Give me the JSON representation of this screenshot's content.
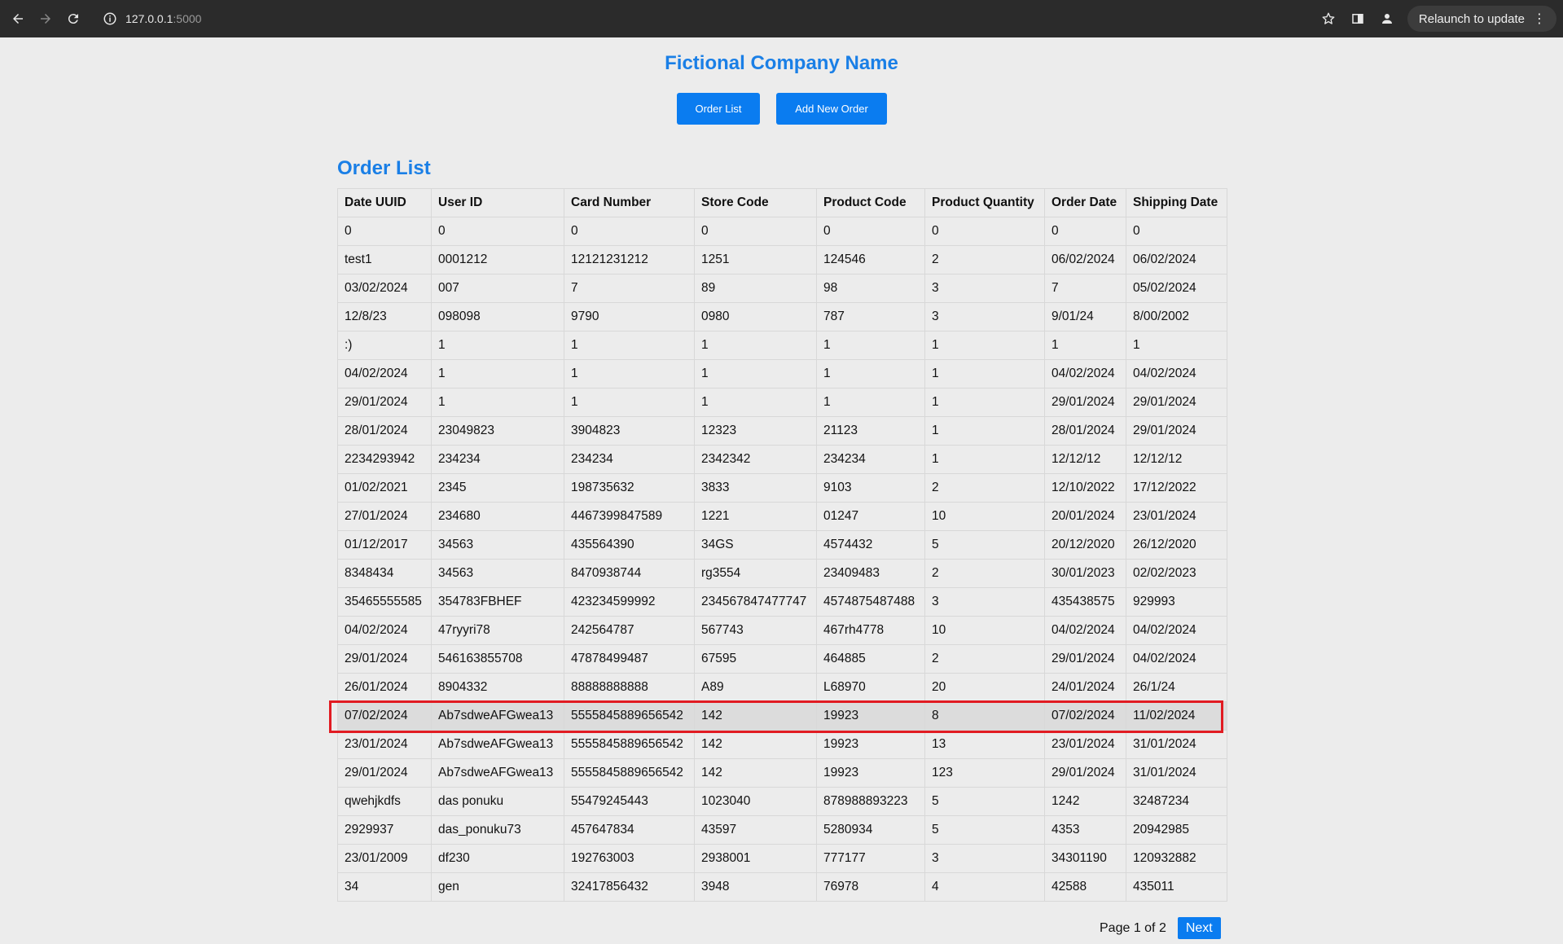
{
  "browser": {
    "url_host": "127.0.0.1",
    "url_port": ":5000",
    "relaunch_label": "Relaunch to update"
  },
  "header": {
    "company": "Fictional Company Name",
    "order_list_button": "Order List",
    "add_order_button": "Add New Order"
  },
  "main": {
    "title": "Order List",
    "columns": [
      "Date UUID",
      "User ID",
      "Card Number",
      "Store Code",
      "Product Code",
      "Product Quantity",
      "Order Date",
      "Shipping Date"
    ],
    "rows": [
      [
        "0",
        "0",
        "0",
        "0",
        "0",
        "0",
        "0",
        "0"
      ],
      [
        "test1",
        "0001212",
        "12121231212",
        "1251",
        "124546",
        "2",
        "06/02/2024",
        "06/02/2024"
      ],
      [
        "03/02/2024",
        "007",
        "7",
        "89",
        "98",
        "3",
        "7",
        "05/02/2024"
      ],
      [
        "12/8/23",
        "098098",
        "9790",
        "0980",
        "787",
        "3",
        "9/01/24",
        "8/00/2002"
      ],
      [
        ":)",
        "1",
        "1",
        "1",
        "1",
        "1",
        "1",
        "1"
      ],
      [
        "04/02/2024",
        "1",
        "1",
        "1",
        "1",
        "1",
        "04/02/2024",
        "04/02/2024"
      ],
      [
        "29/01/2024",
        "1",
        "1",
        "1",
        "1",
        "1",
        "29/01/2024",
        "29/01/2024"
      ],
      [
        "28/01/2024",
        "23049823",
        "3904823",
        "12323",
        "21123",
        "1",
        "28/01/2024",
        "29/01/2024"
      ],
      [
        "2234293942",
        "234234",
        "234234",
        "2342342",
        "234234",
        "1",
        "12/12/12",
        "12/12/12"
      ],
      [
        "01/02/2021",
        "2345",
        "198735632",
        "3833",
        "9103",
        "2",
        "12/10/2022",
        "17/12/2022"
      ],
      [
        "27/01/2024",
        "234680",
        "4467399847589",
        "1221",
        "01247",
        "10",
        "20/01/2024",
        "23/01/2024"
      ],
      [
        "01/12/2017",
        "34563",
        "435564390",
        "34GS",
        "4574432",
        "5",
        "20/12/2020",
        "26/12/2020"
      ],
      [
        "8348434",
        "34563",
        "8470938744",
        "rg3554",
        "23409483",
        "2",
        "30/01/2023",
        "02/02/2023"
      ],
      [
        "35465555585",
        "354783FBHEF",
        "423234599992",
        "234567847477747",
        "4574875487488",
        "3",
        "435438575",
        "929993"
      ],
      [
        "04/02/2024",
        "47ryyri78",
        "242564787",
        "567743",
        "467rh4778",
        "10",
        "04/02/2024",
        "04/02/2024"
      ],
      [
        "29/01/2024",
        "546163855708",
        "47878499487",
        "67595",
        "464885",
        "2",
        "29/01/2024",
        "04/02/2024"
      ],
      [
        "26/01/2024",
        "8904332",
        "88888888888",
        "A89",
        "L68970",
        "20",
        "24/01/2024",
        "26/1/24"
      ],
      [
        "07/02/2024",
        "Ab7sdweAFGwea13",
        "5555845889656542",
        "142",
        "19923",
        "8",
        "07/02/2024",
        "11/02/2024"
      ],
      [
        "23/01/2024",
        "Ab7sdweAFGwea13",
        "5555845889656542",
        "142",
        "19923",
        "13",
        "23/01/2024",
        "31/01/2024"
      ],
      [
        "29/01/2024",
        "Ab7sdweAFGwea13",
        "5555845889656542",
        "142",
        "19923",
        "123",
        "29/01/2024",
        "31/01/2024"
      ],
      [
        "qwehjkdfs",
        "das ponuku",
        "55479245443",
        "1023040",
        "878988893223",
        "5",
        "1242",
        "32487234"
      ],
      [
        "2929937",
        "das_ponuku73",
        "457647834",
        "43597",
        "5280934",
        "5",
        "4353",
        "20942985"
      ],
      [
        "23/01/2009",
        "df230",
        "192763003",
        "2938001",
        "777177",
        "3",
        "34301190",
        "120932882"
      ],
      [
        "34",
        "gen",
        "32417856432",
        "3948",
        "76978",
        "4",
        "42588",
        "435011"
      ]
    ],
    "selected_row": 17
  },
  "pagination": {
    "page_info": "Page 1 of 2",
    "next_label": "Next"
  },
  "colors": {
    "accent": "#0a7cf0",
    "highlight": "#e11b22"
  }
}
